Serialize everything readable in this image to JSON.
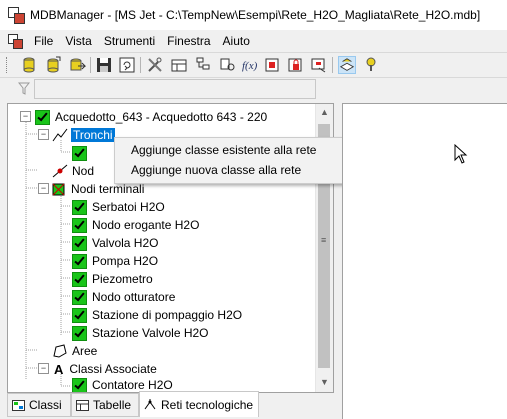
{
  "window": {
    "title": "MDBManager - [MS Jet - C:\\TempNew\\Esempi\\Rete_H2O_Magliata\\Rete_H2O.mdb]"
  },
  "menu": [
    "File",
    "Vista",
    "Strumenti",
    "Finestra",
    "Aiuto"
  ],
  "toolbar": {
    "buttons": [
      "db-open-icon",
      "db-new-icon",
      "db-attach-icon",
      "save-icon",
      "refresh-icon",
      "tools-icon",
      "table-icon",
      "tree-icon",
      "key-icon",
      "function-icon",
      "network-icon",
      "lock-icon",
      "export-icon",
      "layer-icon",
      "info-icon"
    ]
  },
  "filter": {
    "value": ""
  },
  "tree": {
    "root": "Acquedotto_643 - Acquedotto 643 - 220",
    "tronchi": "Tronchi",
    "nodi_partial": "Nod",
    "nodi_terminali": "Nodi terminali",
    "terminali": [
      "Serbatoi H2O",
      "Nodo erogante H2O",
      "Valvola H2O",
      "Pompa H2O",
      "Piezometro",
      "Nodo otturatore",
      "Stazione di pompaggio H2O",
      "Stazione Valvole H2O"
    ],
    "aree": "Aree",
    "classi_associate": "Classi Associate",
    "contatore": "Contatore H2O"
  },
  "context_menu": {
    "items": [
      "Aggiunge classe esistente alla rete",
      "Aggiunge nuova classe alla rete"
    ]
  },
  "tabs": [
    "Classi",
    "Tabelle",
    "Reti tecnologiche"
  ],
  "colors": {
    "selection": "#0078d7",
    "check": "#19c419"
  }
}
